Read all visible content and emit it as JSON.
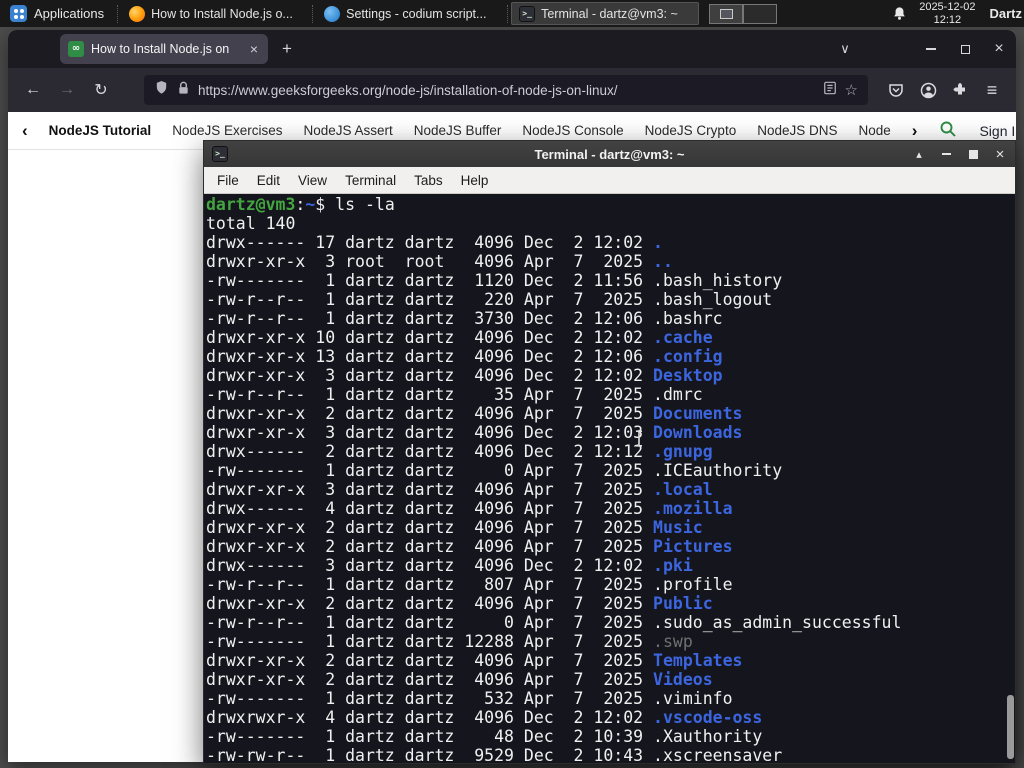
{
  "colors": {
    "term_bg": "#15151e",
    "term_fg": "#f0f0f0",
    "term_green": "#44a63f",
    "term_blue": "#3c66e0",
    "term_dim": "#707070",
    "gfg_green": "#2f8d46"
  },
  "glyphs": {
    "back": "←",
    "forward": "→",
    "reload": "↻",
    "plus": "+",
    "close": "×",
    "chevron_down": "∨",
    "menu": "≡",
    "star": "☆",
    "nav_left": "‹",
    "nav_right": "›",
    "shade": "▴",
    "favicon_mark": "∞",
    "term_mark": ">_"
  },
  "panel": {
    "applications_label": "Applications",
    "tasks": [
      {
        "label": "How to Install Node.js o...",
        "icon": "firefox-icon"
      },
      {
        "label": "Settings - codium script...",
        "icon": "vscodium-icon"
      },
      {
        "label": "Terminal - dartz@vm3: ~",
        "icon": "terminal-icon"
      }
    ],
    "clock": {
      "date": "2025-12-02",
      "time": "12:12"
    },
    "user_label": "Dartz"
  },
  "browser": {
    "tab_title": "How to Install Node.js on",
    "url": "https://www.geeksforgeeks.org/node-js/installation-of-node-js-on-linux/",
    "site_nav": {
      "items": [
        "NodeJS Tutorial",
        "NodeJS Exercises",
        "NodeJS Assert",
        "NodeJS Buffer",
        "NodeJS Console",
        "NodeJS Crypto",
        "NodeJS DNS",
        "Node"
      ],
      "sign_in": "Sign In"
    }
  },
  "terminal": {
    "title": "Terminal - dartz@vm3: ~",
    "menus": [
      "File",
      "Edit",
      "View",
      "Terminal",
      "Tabs",
      "Help"
    ],
    "prompt": {
      "user_host": "dartz@vm3",
      "path": "~",
      "command": "ls -la"
    },
    "total_line": "total 140",
    "entries": [
      {
        "perm": "drwx------",
        "ln": "17",
        "own": "dartz",
        "grp": "dartz",
        "size": "4096",
        "mon": "Dec",
        "day": "2",
        "tim": "12:02",
        "name": ".",
        "type": "dir"
      },
      {
        "perm": "drwxr-xr-x",
        "ln": "3",
        "own": "root",
        "grp": "root",
        "size": "4096",
        "mon": "Apr",
        "day": "7",
        "tim": "2025",
        "name": "..",
        "type": "dir"
      },
      {
        "perm": "-rw-------",
        "ln": "1",
        "own": "dartz",
        "grp": "dartz",
        "size": "1120",
        "mon": "Dec",
        "day": "2",
        "tim": "11:56",
        "name": ".bash_history",
        "type": "file"
      },
      {
        "perm": "-rw-r--r--",
        "ln": "1",
        "own": "dartz",
        "grp": "dartz",
        "size": "220",
        "mon": "Apr",
        "day": "7",
        "tim": "2025",
        "name": ".bash_logout",
        "type": "file"
      },
      {
        "perm": "-rw-r--r--",
        "ln": "1",
        "own": "dartz",
        "grp": "dartz",
        "size": "3730",
        "mon": "Dec",
        "day": "2",
        "tim": "12:06",
        "name": ".bashrc",
        "type": "file"
      },
      {
        "perm": "drwxr-xr-x",
        "ln": "10",
        "own": "dartz",
        "grp": "dartz",
        "size": "4096",
        "mon": "Dec",
        "day": "2",
        "tim": "12:02",
        "name": ".cache",
        "type": "dir"
      },
      {
        "perm": "drwxr-xr-x",
        "ln": "13",
        "own": "dartz",
        "grp": "dartz",
        "size": "4096",
        "mon": "Dec",
        "day": "2",
        "tim": "12:06",
        "name": ".config",
        "type": "dir"
      },
      {
        "perm": "drwxr-xr-x",
        "ln": "3",
        "own": "dartz",
        "grp": "dartz",
        "size": "4096",
        "mon": "Dec",
        "day": "2",
        "tim": "12:02",
        "name": "Desktop",
        "type": "dir"
      },
      {
        "perm": "-rw-r--r--",
        "ln": "1",
        "own": "dartz",
        "grp": "dartz",
        "size": "35",
        "mon": "Apr",
        "day": "7",
        "tim": "2025",
        "name": ".dmrc",
        "type": "file"
      },
      {
        "perm": "drwxr-xr-x",
        "ln": "2",
        "own": "dartz",
        "grp": "dartz",
        "size": "4096",
        "mon": "Apr",
        "day": "7",
        "tim": "2025",
        "name": "Documents",
        "type": "dir"
      },
      {
        "perm": "drwxr-xr-x",
        "ln": "3",
        "own": "dartz",
        "grp": "dartz",
        "size": "4096",
        "mon": "Dec",
        "day": "2",
        "tim": "12:03",
        "name": "Downloads",
        "type": "dir"
      },
      {
        "perm": "drwx------",
        "ln": "2",
        "own": "dartz",
        "grp": "dartz",
        "size": "4096",
        "mon": "Dec",
        "day": "2",
        "tim": "12:12",
        "name": ".gnupg",
        "type": "dir"
      },
      {
        "perm": "-rw-------",
        "ln": "1",
        "own": "dartz",
        "grp": "dartz",
        "size": "0",
        "mon": "Apr",
        "day": "7",
        "tim": "2025",
        "name": ".ICEauthority",
        "type": "file"
      },
      {
        "perm": "drwxr-xr-x",
        "ln": "3",
        "own": "dartz",
        "grp": "dartz",
        "size": "4096",
        "mon": "Apr",
        "day": "7",
        "tim": "2025",
        "name": ".local",
        "type": "dir"
      },
      {
        "perm": "drwx------",
        "ln": "4",
        "own": "dartz",
        "grp": "dartz",
        "size": "4096",
        "mon": "Apr",
        "day": "7",
        "tim": "2025",
        "name": ".mozilla",
        "type": "dir"
      },
      {
        "perm": "drwxr-xr-x",
        "ln": "2",
        "own": "dartz",
        "grp": "dartz",
        "size": "4096",
        "mon": "Apr",
        "day": "7",
        "tim": "2025",
        "name": "Music",
        "type": "dir"
      },
      {
        "perm": "drwxr-xr-x",
        "ln": "2",
        "own": "dartz",
        "grp": "dartz",
        "size": "4096",
        "mon": "Apr",
        "day": "7",
        "tim": "2025",
        "name": "Pictures",
        "type": "dir"
      },
      {
        "perm": "drwx------",
        "ln": "3",
        "own": "dartz",
        "grp": "dartz",
        "size": "4096",
        "mon": "Dec",
        "day": "2",
        "tim": "12:02",
        "name": ".pki",
        "type": "dir"
      },
      {
        "perm": "-rw-r--r--",
        "ln": "1",
        "own": "dartz",
        "grp": "dartz",
        "size": "807",
        "mon": "Apr",
        "day": "7",
        "tim": "2025",
        "name": ".profile",
        "type": "file"
      },
      {
        "perm": "drwxr-xr-x",
        "ln": "2",
        "own": "dartz",
        "grp": "dartz",
        "size": "4096",
        "mon": "Apr",
        "day": "7",
        "tim": "2025",
        "name": "Public",
        "type": "dir"
      },
      {
        "perm": "-rw-r--r--",
        "ln": "1",
        "own": "dartz",
        "grp": "dartz",
        "size": "0",
        "mon": "Apr",
        "day": "7",
        "tim": "2025",
        "name": ".sudo_as_admin_successful",
        "type": "file"
      },
      {
        "perm": "-rw-------",
        "ln": "1",
        "own": "dartz",
        "grp": "dartz",
        "size": "12288",
        "mon": "Apr",
        "day": "7",
        "tim": "2025",
        "name": ".swp",
        "type": "dim"
      },
      {
        "perm": "drwxr-xr-x",
        "ln": "2",
        "own": "dartz",
        "grp": "dartz",
        "size": "4096",
        "mon": "Apr",
        "day": "7",
        "tim": "2025",
        "name": "Templates",
        "type": "dir"
      },
      {
        "perm": "drwxr-xr-x",
        "ln": "2",
        "own": "dartz",
        "grp": "dartz",
        "size": "4096",
        "mon": "Apr",
        "day": "7",
        "tim": "2025",
        "name": "Videos",
        "type": "dir"
      },
      {
        "perm": "-rw-------",
        "ln": "1",
        "own": "dartz",
        "grp": "dartz",
        "size": "532",
        "mon": "Apr",
        "day": "7",
        "tim": "2025",
        "name": ".viminfo",
        "type": "file"
      },
      {
        "perm": "drwxrwxr-x",
        "ln": "4",
        "own": "dartz",
        "grp": "dartz",
        "size": "4096",
        "mon": "Dec",
        "day": "2",
        "tim": "12:02",
        "name": ".vscode-oss",
        "type": "dir"
      },
      {
        "perm": "-rw-------",
        "ln": "1",
        "own": "dartz",
        "grp": "dartz",
        "size": "48",
        "mon": "Dec",
        "day": "2",
        "tim": "10:39",
        "name": ".Xauthority",
        "type": "file"
      },
      {
        "perm": "-rw-rw-r--",
        "ln": "1",
        "own": "dartz",
        "grp": "dartz",
        "size": "9529",
        "mon": "Dec",
        "day": "2",
        "tim": "10:43",
        "name": ".xscreensaver",
        "type": "file"
      }
    ]
  }
}
